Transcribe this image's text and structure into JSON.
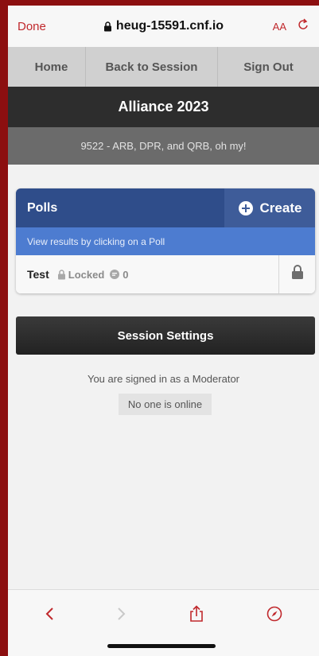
{
  "safari": {
    "done_label": "Done",
    "url": "heug-15591.cnf.io",
    "text_size_label": "AA"
  },
  "nav": {
    "home": "Home",
    "back": "Back to Session",
    "signout": "Sign Out"
  },
  "header": {
    "title": "Alliance 2023",
    "session": "9522 - ARB, DPR, and QRB, oh my!"
  },
  "polls": {
    "title": "Polls",
    "create_label": "Create",
    "hint": "View results by clicking on a Poll",
    "items": [
      {
        "name": "Test",
        "status": "Locked",
        "count": "0"
      }
    ]
  },
  "settings": {
    "button_label": "Session Settings",
    "signed_in": "You are signed in as a Moderator",
    "online": "No one is online"
  },
  "colors": {
    "accent": "#c0282c",
    "polls_header": "#2f4d8a",
    "polls_hint": "#4d7cd0",
    "dark_bar": "#2d2d2d"
  },
  "icons": [
    "lock-icon",
    "reload-icon",
    "plus-circle-icon",
    "comment-icon",
    "back-chevron-icon",
    "forward-chevron-icon",
    "share-icon",
    "compass-icon"
  ]
}
